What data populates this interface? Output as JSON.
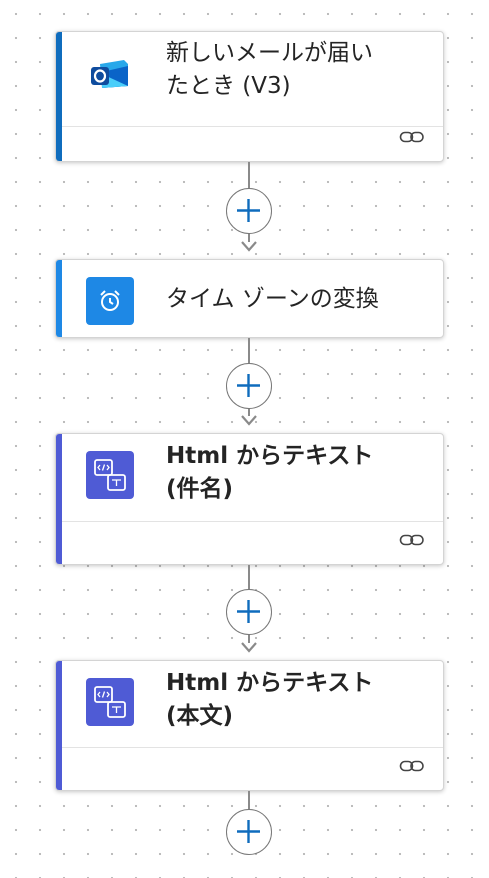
{
  "flow": {
    "steps": [
      {
        "title_line1": "新しいメールが届い",
        "title_line2": "たとき (V3)",
        "icon": "outlook-icon",
        "accent_color": "#0f6cbd",
        "has_link": true
      },
      {
        "title_line1": "タイム ゾーンの変換",
        "icon": "alarm-clock-icon",
        "accent_color": "#1e88e5",
        "has_link": false
      },
      {
        "title_line1": "Html からテキスト",
        "title_line2": "(件名)",
        "icon": "html-to-text-icon",
        "accent_color": "#4f5bd5",
        "has_link": true
      },
      {
        "title_line1": "Html からテキスト",
        "title_line2": "(本文)",
        "icon": "html-to-text-icon",
        "accent_color": "#4f5bd5",
        "has_link": true
      }
    ],
    "add_step_icon": "plus-icon",
    "link_icon": "link-icon"
  }
}
